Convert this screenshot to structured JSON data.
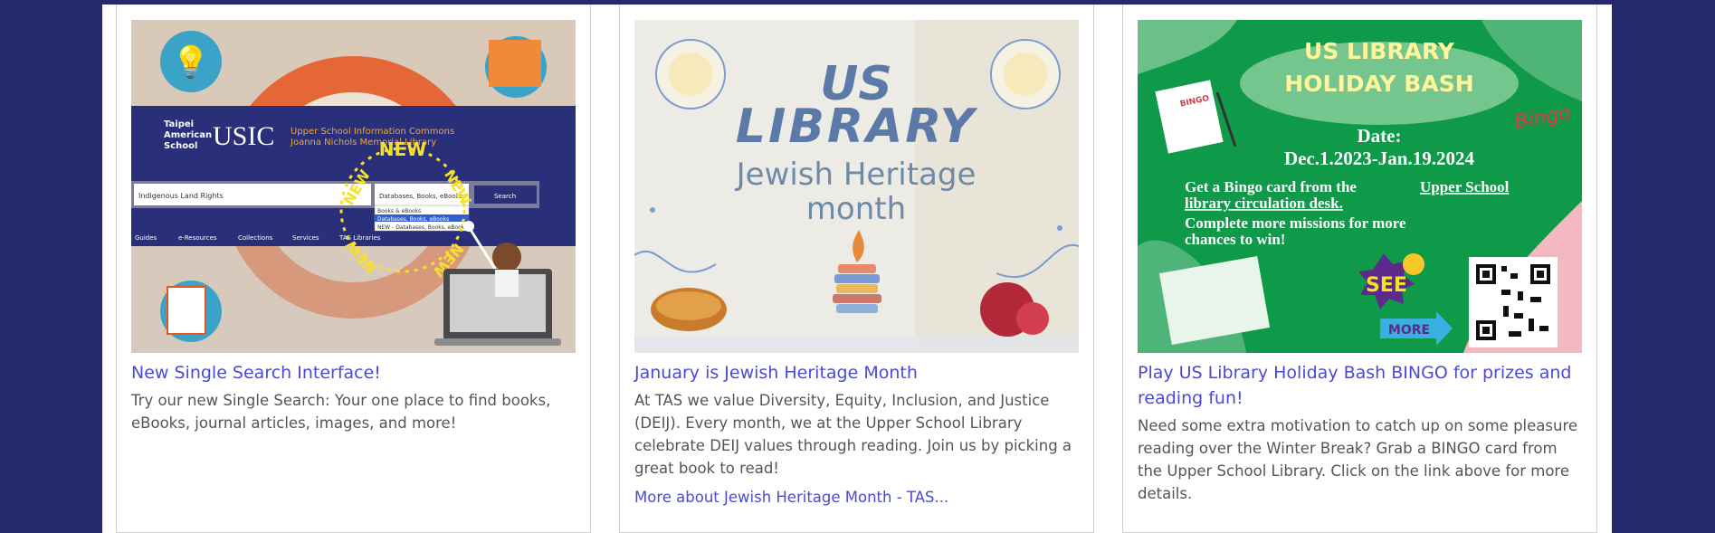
{
  "cards": [
    {
      "title": "New Single Search Interface!",
      "description": "Try our new Single Search: Your one place to find books, eBooks, journal articles, images, and more!",
      "image": {
        "school_line1": "Taipei",
        "school_line2": "American",
        "school_line3": "School",
        "brand": "USIC",
        "sub1": "Upper School Information Commons",
        "sub2": "Joanna Nichols Memorial Library",
        "search_value": "Indigenous Land Rights",
        "select_value": "Databases, Books, eBooks",
        "option1": "Books & eBooks",
        "option2": "Databases, Books, eBooks",
        "option3": "NEW - Databases, Books, eBooks",
        "search_button": "Search",
        "nav": [
          "Guides",
          "e-Resources",
          "Collections",
          "Services",
          "TAS Libraries"
        ],
        "badge": "NEW"
      }
    },
    {
      "title": "January is Jewish Heritage Month",
      "description": "At TAS we value Diversity, Equity, Inclusion, and Justice (DEIJ). Every month, we at the Upper School Library celebrate DEIJ values through reading. Join us by picking a great book to read!",
      "link": "More about Jewish Heritage Month - TAS...",
      "image": {
        "line1": "US",
        "line2": "LIBRARY",
        "line3": "Jewish Heritage",
        "line4": "month"
      }
    },
    {
      "title": "Play US Library Holiday Bash BINGO for prizes and reading fun!",
      "description": "Need some extra motivation to catch up on some pleasure reading over the Winter Break? Grab a BINGO card from the Upper School Library. Click on the link above for more details.",
      "image": {
        "heading1": "US LIBRARY",
        "heading2": "HOLIDAY BASH",
        "date_label": "Date:",
        "date_range": "Dec.1.2023-Jan.19.2024",
        "body1": "Get a Bingo card from the",
        "body1_link": "Upper School",
        "body2": "library circulation desk.",
        "body3": "Complete more missions for more",
        "body4": "chances to win!",
        "bingo_badge": "Bingo",
        "card_header": "BINGO",
        "see": "SEE",
        "more": "MORE"
      }
    }
  ],
  "colors": {
    "page_bg": "#25286b",
    "link": "#4a4ad6",
    "text": "#555555",
    "bingo_green": "#0f9a4a"
  }
}
